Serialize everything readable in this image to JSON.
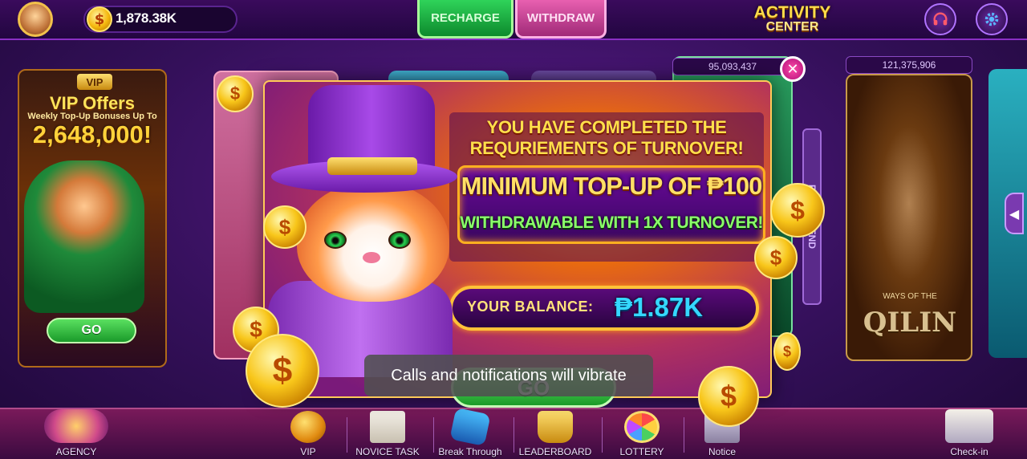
{
  "topbar": {
    "balance": "1,878.38K",
    "currency_symbol": "$",
    "recharge_label": "RECHARGE",
    "withdraw_label": "WITHDRAW",
    "activity_line1": "ACTIVITY",
    "activity_line2": "CENTER"
  },
  "vip_card": {
    "badge": "VIP",
    "title": "VIP Offers",
    "subtitle": "Weekly Top-Up Bonuses Up To",
    "amount": "2,648,000!",
    "go_label": "GO"
  },
  "game_cards": {
    "jackpot_left": "95,093,437",
    "jackpot_right": "121,375,906",
    "qilin_small": "WAYS OF THE",
    "qilin_title": "QILIN",
    "side_tab": "RECOMMEND"
  },
  "popup": {
    "headline_line1": "YOU HAVE COMPLETED THE",
    "headline_line2": "REQURIEMENTS OF TURNOVER!",
    "minimum": "MINIMUM TOP-UP OF ₱100",
    "withdrawable": "WITHDRAWABLE WITH 1X TURNOVER!",
    "balance_label": "YOUR BALANCE:",
    "balance_value": "₱1.87K",
    "go_label": "GO",
    "close_symbol": "✕"
  },
  "bottom_nav": [
    {
      "label": "AGENCY",
      "icon": "agency-icon"
    },
    {
      "label": "VIP",
      "icon": "vip-icon"
    },
    {
      "label": "NOVICE TASK",
      "icon": "novice-task-icon"
    },
    {
      "label": "Break Through",
      "icon": "break-through-icon"
    },
    {
      "label": "LEADERBOARD",
      "icon": "leaderboard-icon"
    },
    {
      "label": "LOTTERY",
      "icon": "lottery-icon"
    },
    {
      "label": "Notice",
      "icon": "notice-icon"
    },
    {
      "label": "Check-in",
      "icon": "check-in-icon"
    }
  ],
  "toast": {
    "message": "Calls and notifications will vibrate"
  },
  "colors": {
    "accent_gold": "#ffdf4a",
    "balance_cyan": "#35d8ff",
    "go_green": "#1a9a28",
    "background_purple": "#34105a"
  }
}
